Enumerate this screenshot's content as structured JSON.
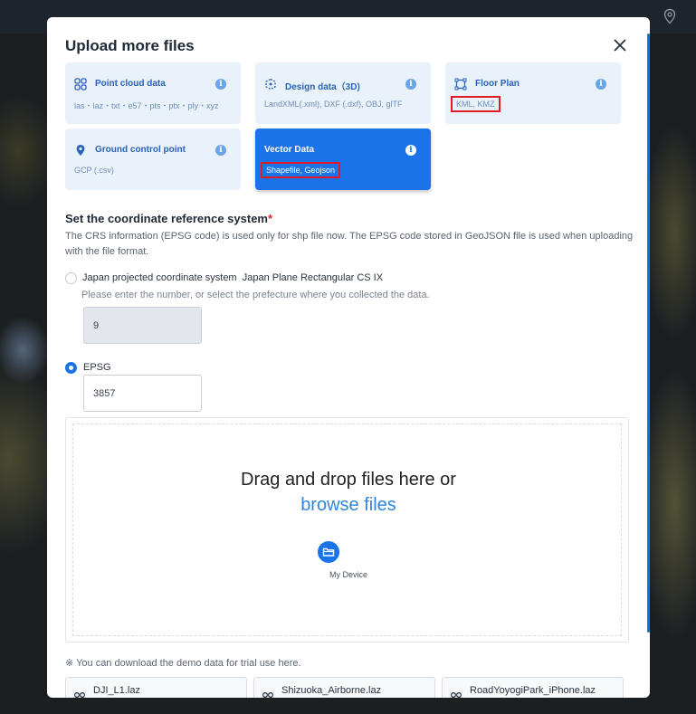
{
  "modal": {
    "title": "Upload more files"
  },
  "cards": [
    {
      "title": "Point cloud data",
      "formats": "las・laz・txt・e57・pts・ptx・ply・xyz",
      "icon": "grid-icon"
    },
    {
      "title": "Design data（3D)",
      "formats": "LandXML(.xml), DXF (.dxf), OBJ, glTF",
      "icon": "cube-icon"
    },
    {
      "title": "Floor Plan",
      "formats": "KML, KMZ",
      "icon": "floor-plan-icon"
    },
    {
      "title": "Ground control point",
      "formats": "GCP (.csv)",
      "icon": "location-pin-icon"
    },
    {
      "title": "Vector Data",
      "formats": "Shapefile, Geojson",
      "selected": true
    }
  ],
  "crs": {
    "title": "Set the coordinate reference system",
    "required_mark": "*",
    "description": "The CRS information (EPSG code) is used only for shp file now. The EPSG code stored in GeoJSON file is used when uploading with the file format.",
    "option_japan_label": "Japan projected coordinate system",
    "option_japan_value": "Japan Plane Rectangular CS IX",
    "hint": "Please enter the number, or select the prefecture where you collected the data.",
    "japan_input": "9",
    "option_epsg_label": "EPSG",
    "epsg_input": "3857",
    "selected": "EPSG"
  },
  "dropzone": {
    "text": "Drag and drop files here or",
    "link": "browse files",
    "device_label": "My Device"
  },
  "demo": {
    "note": "※ You can download the demo data for trial use here.",
    "files": [
      "DJI_L1.laz",
      "Shizuoka_Airborne.laz",
      "RoadYoyogiPark_iPhone.laz"
    ]
  },
  "colors": {
    "accent": "#1a73e8",
    "card_bg": "#e9f2fb",
    "highlight": "#e01b24"
  }
}
